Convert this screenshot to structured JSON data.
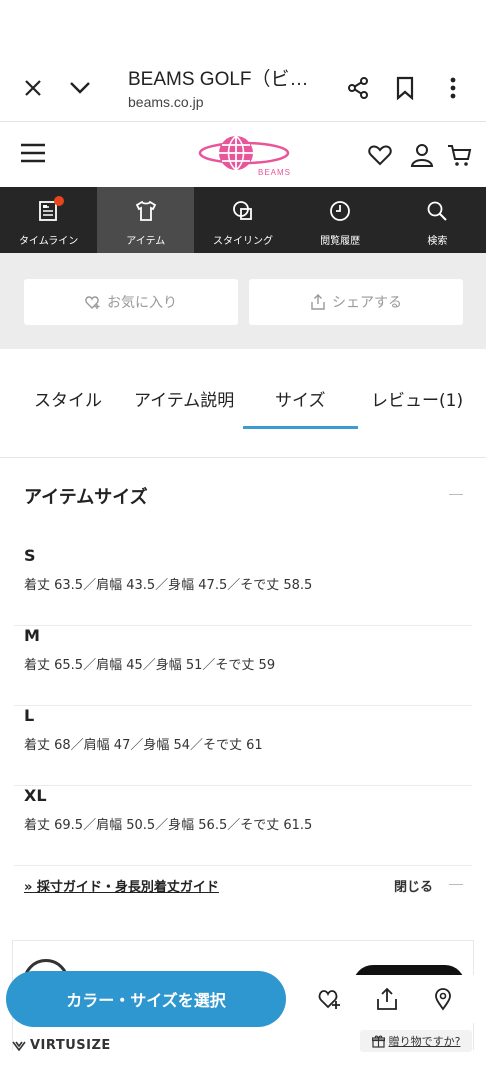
{
  "browser": {
    "title": "BEAMS GOLF（ビ…",
    "url": "beams.co.jp"
  },
  "site": {
    "logo_text": "BEAMS",
    "brand_color": "#e8559a"
  },
  "nav": {
    "items": [
      {
        "label": "タイムライン",
        "icon": "timeline-icon"
      },
      {
        "label": "アイテム",
        "icon": "shirt-icon"
      },
      {
        "label": "スタイリング",
        "icon": "styling-icon"
      },
      {
        "label": "閲覧履歴",
        "icon": "clock-icon"
      },
      {
        "label": "検索",
        "icon": "search-icon"
      }
    ]
  },
  "actions": {
    "favorite": "お気に入り",
    "share": "シェアする"
  },
  "tabs": [
    {
      "label": "スタイル"
    },
    {
      "label": "アイテム説明"
    },
    {
      "label": "サイズ"
    },
    {
      "label": "レビュー(1)"
    }
  ],
  "size_section": {
    "title": "アイテムサイズ",
    "sizes": [
      {
        "name": "S",
        "desc": "着丈 63.5／肩幅 43.5／身幅 47.5／そで丈 58.5"
      },
      {
        "name": "M",
        "desc": "着丈 65.5／肩幅 45／身幅 51／そで丈 59"
      },
      {
        "name": "L",
        "desc": "着丈 68／肩幅 47／身幅 54／そで丈 61"
      },
      {
        "name": "XL",
        "desc": "着丈 69.5／肩幅 50.5／身幅 56.5／そで丈 61.5"
      }
    ],
    "guide_link": "» 採寸ガイド・身長別着丈ガイド",
    "close_label": "閉じる"
  },
  "bottom": {
    "select_button": "カラー・サイズを選択",
    "virtusize": "VIRTUSIZE",
    "gift": "贈り物ですか?",
    "accent_color": "#2f97cf"
  }
}
